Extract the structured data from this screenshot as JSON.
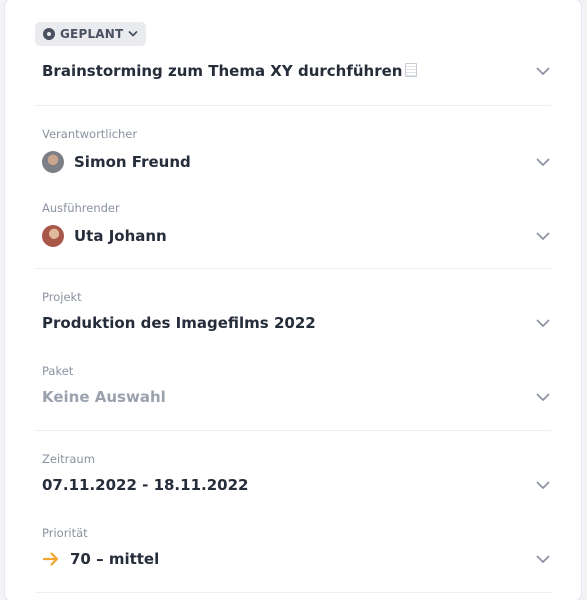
{
  "status": {
    "label": "GEPLANT",
    "icon": "status-dot-icon"
  },
  "task": {
    "title": "Brainstorming zum Thema XY durchführen",
    "title_icon": "document-icon"
  },
  "fields": {
    "responsible": {
      "label": "Verantwortlicher",
      "value": "Simon Freund"
    },
    "executor": {
      "label": "Ausführender",
      "value": "Uta Johann"
    },
    "project": {
      "label": "Projekt",
      "value": "Produktion des Imagefilms 2022"
    },
    "package": {
      "label": "Paket",
      "value": "Keine Auswahl"
    },
    "period": {
      "label": "Zeitraum",
      "value": "07.11.2022 - 18.11.2022"
    },
    "priority": {
      "label": "Priorität",
      "value": "70 – mittel",
      "icon": "arrow-right-icon"
    }
  },
  "colors": {
    "priority_arrow": "#f0a830",
    "muted_text": "#9aa2ae",
    "chevron": "#8d94a1"
  }
}
